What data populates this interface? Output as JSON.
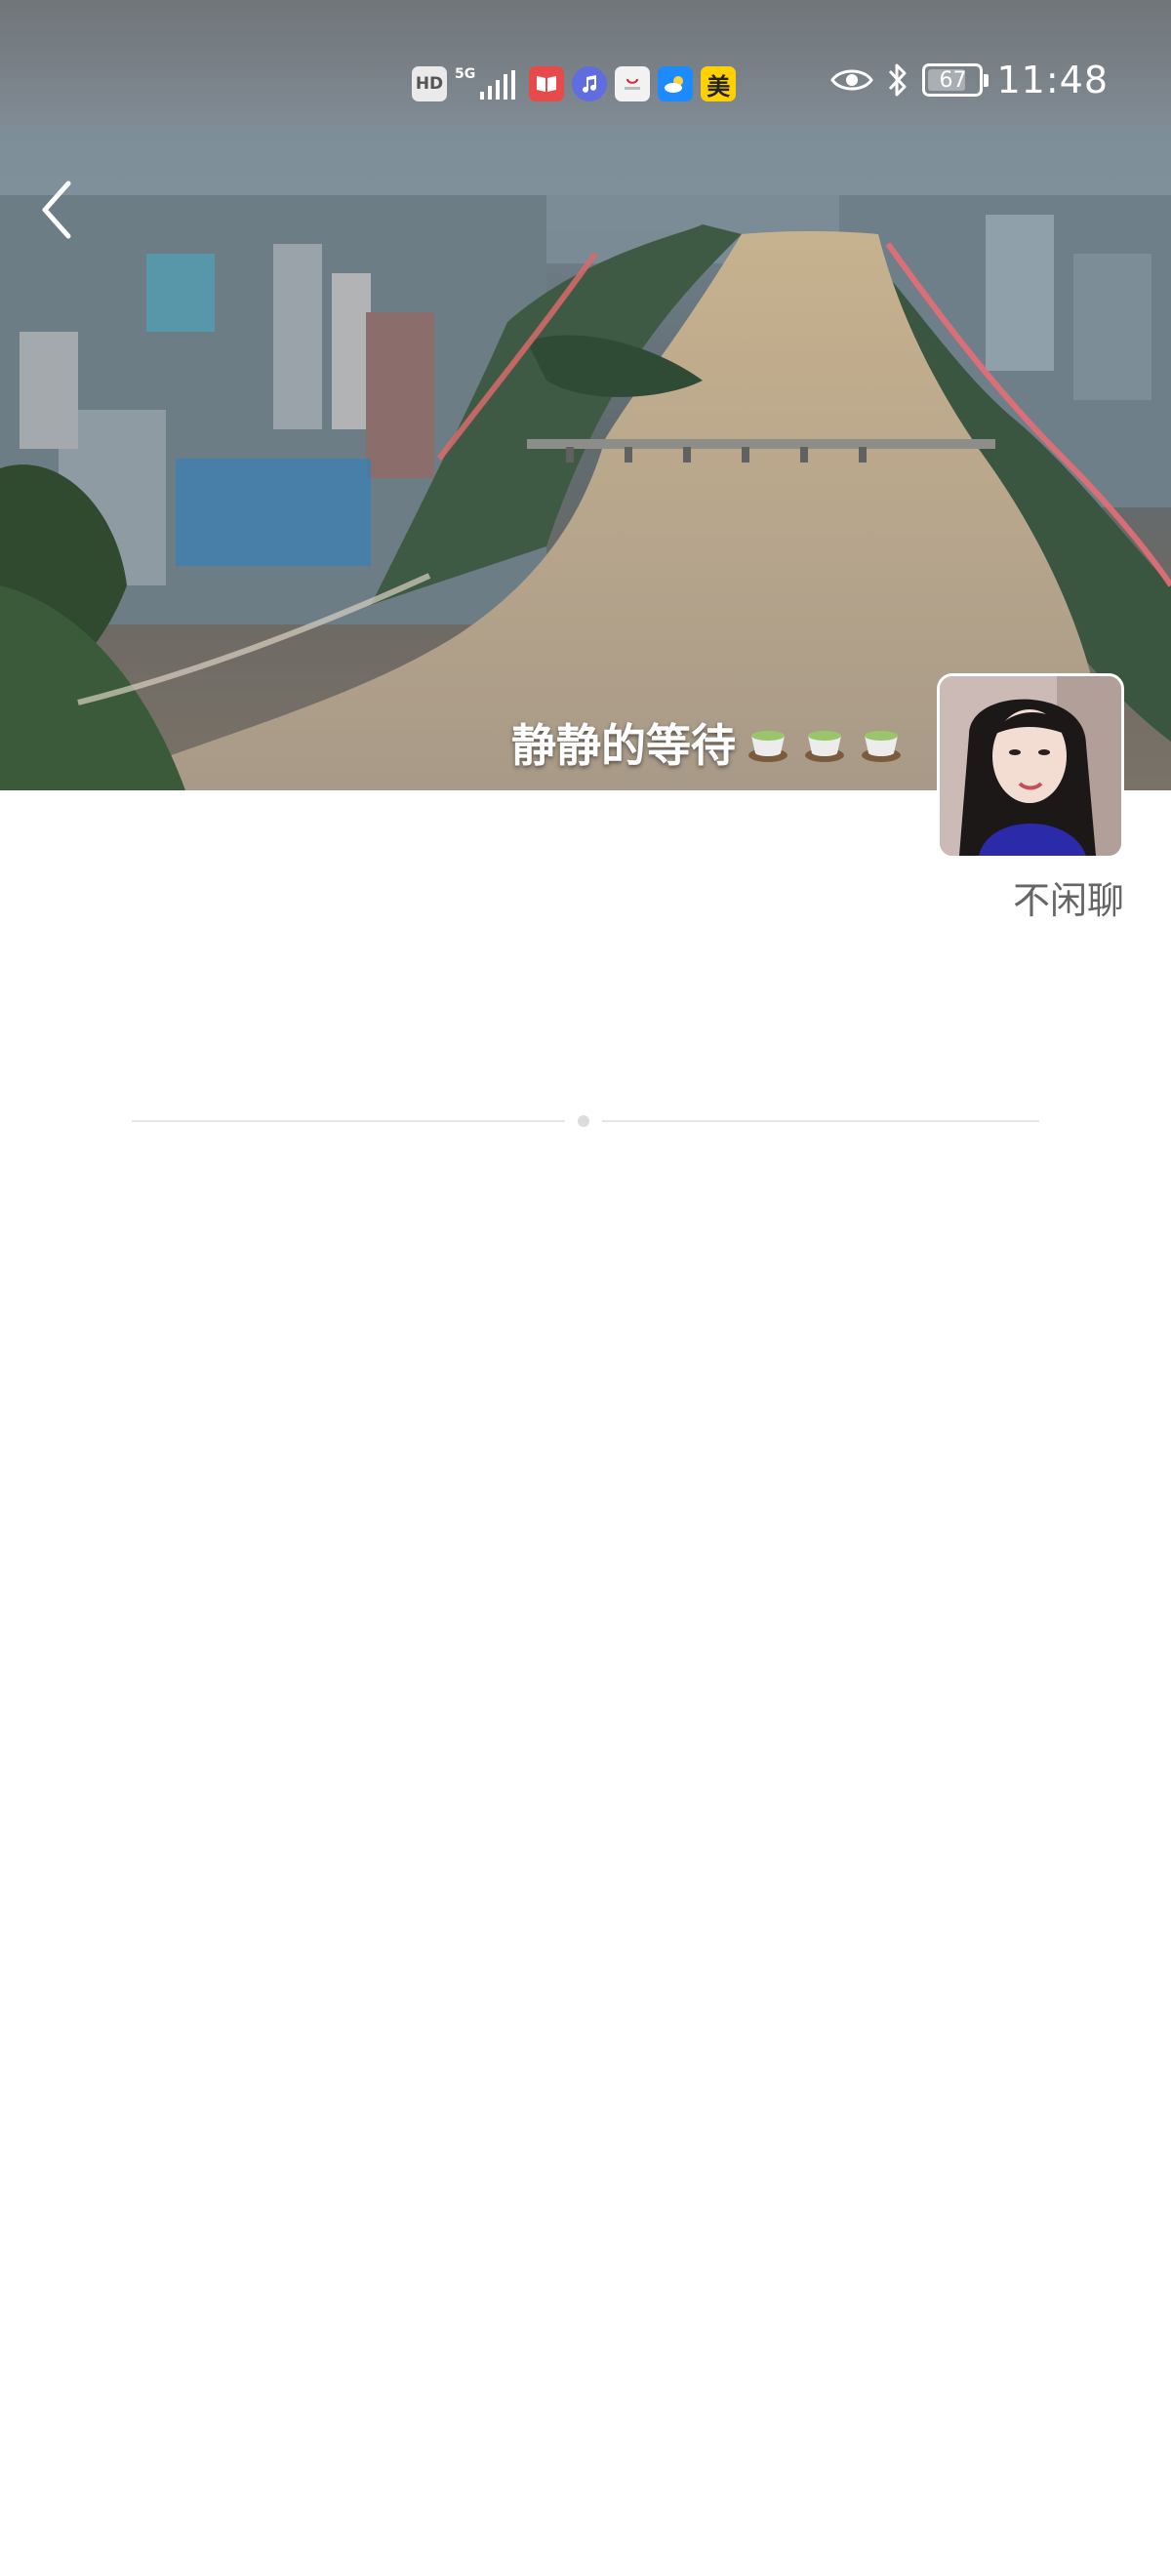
{
  "status_bar": {
    "hd_label": "HD",
    "network_label": "5G",
    "app_icons": [
      "book-app-icon",
      "music-app-icon",
      "huawei-store-icon",
      "weather-app-icon",
      "meituan-app-icon"
    ],
    "meituan_label": "美",
    "battery_level": "67",
    "time": "11:48"
  },
  "cover": {
    "caption": "静静的等待",
    "caption_emoji_icon": "tea-cup-icon",
    "caption_emoji_count": 3
  },
  "profile": {
    "nickname": "不闲聊"
  },
  "colors": {
    "accent_red": "#e64a4a",
    "meituan_yellow": "#ffd100",
    "weather_blue": "#1d8bff",
    "nickname_gray": "#666666",
    "divider_gray": "#e5e5e5"
  }
}
